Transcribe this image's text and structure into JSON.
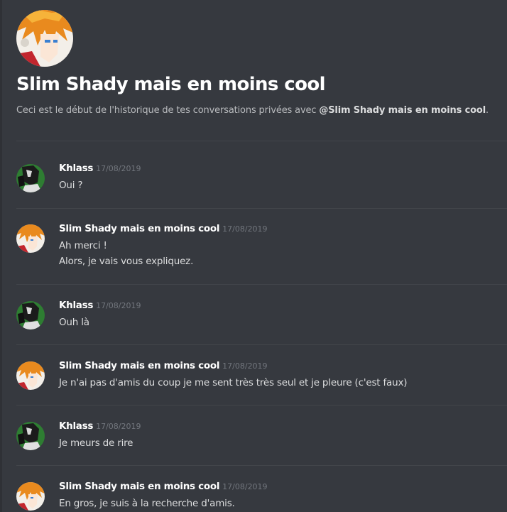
{
  "header": {
    "title": "Slim Shady mais en moins cool",
    "subtitle_prefix": "Ceci est le début de l'historique de tes conversations privées avec ",
    "subtitle_mention": "@Slim Shady mais en moins cool",
    "subtitle_suffix": ".",
    "avatar_icon": "anime-avatar-icon"
  },
  "messages": [
    {
      "author": "Khlass",
      "time": "17/08/2019",
      "lines": [
        "Oui ?"
      ]
    },
    {
      "author": "Slim Shady mais en moins cool",
      "time": "17/08/2019",
      "lines": [
        "Ah merci !",
        "Alors, je vais vous expliquez."
      ]
    },
    {
      "author": "Khlass",
      "time": "17/08/2019",
      "lines": [
        "Ouh là"
      ]
    },
    {
      "author": "Slim Shady mais en moins cool",
      "time": "17/08/2019",
      "lines": [
        "Je n'ai pas d'amis du coup je me sent très très seul et je pleure (c'est faux)"
      ]
    },
    {
      "author": "Khlass",
      "time": "17/08/2019",
      "lines": [
        "Je meurs de rire"
      ]
    },
    {
      "author": "Slim Shady mais en moins cool",
      "time": "17/08/2019",
      "lines": [
        "En gros, je suis à la recherche d'amis."
      ]
    }
  ],
  "colors": {
    "background": "#36393f",
    "author": "#ffffff",
    "text": "#dcddde",
    "timestamp": "#72767d",
    "khlass_avatar_green": "#2e7d32"
  }
}
